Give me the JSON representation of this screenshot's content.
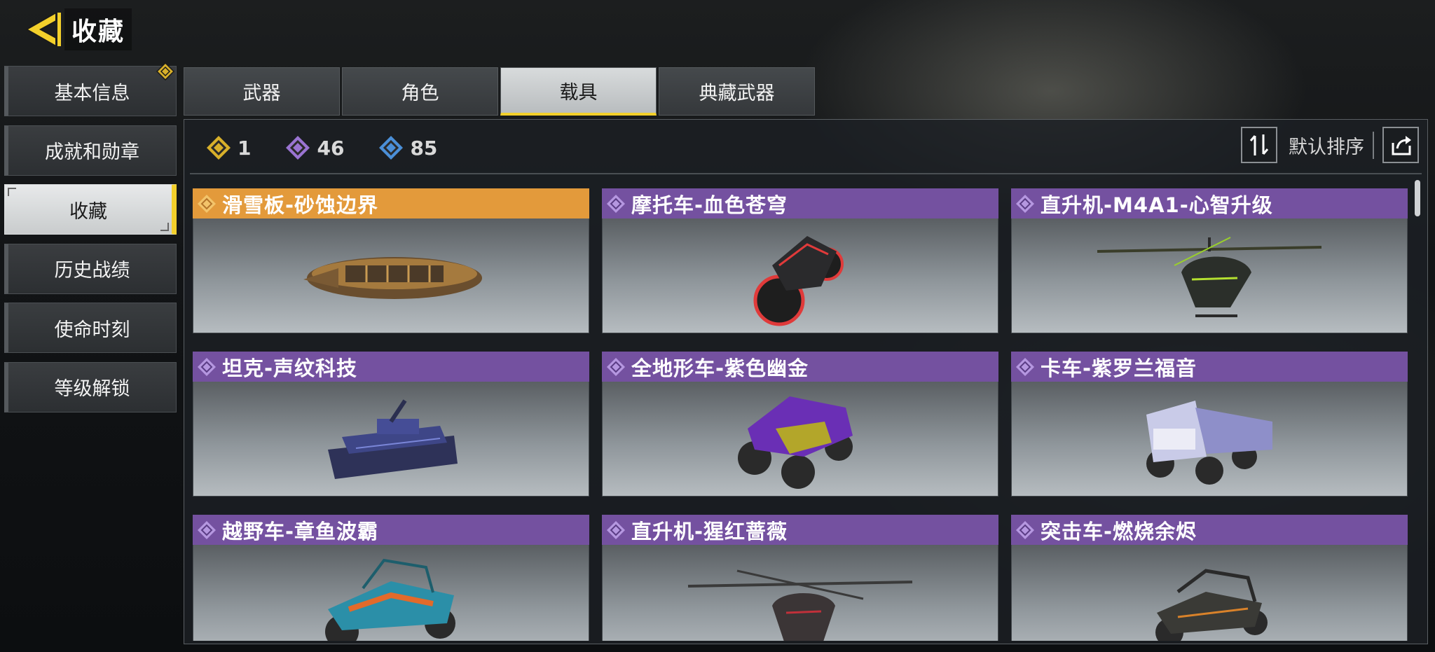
{
  "header": {
    "title": "收藏"
  },
  "sidebar": {
    "items": [
      {
        "label": "基本信息"
      },
      {
        "label": "成就和勋章"
      },
      {
        "label": "收藏"
      },
      {
        "label": "历史战绩"
      },
      {
        "label": "使命时刻"
      },
      {
        "label": "等级解锁"
      }
    ]
  },
  "tabs": [
    {
      "label": "武器"
    },
    {
      "label": "角色"
    },
    {
      "label": "载具"
    },
    {
      "label": "典藏武器"
    }
  ],
  "stats": {
    "legendary": "1",
    "epic": "46",
    "rare": "85"
  },
  "sort": {
    "label": "默认排序"
  },
  "cards": [
    {
      "name": "滑雪板-砂蚀边界",
      "rarity": "legendary"
    },
    {
      "name": "摩托车-血色苍穹",
      "rarity": "epic"
    },
    {
      "name": "直升机-M4A1-心智升级",
      "rarity": "epic"
    },
    {
      "name": "坦克-声纹科技",
      "rarity": "epic"
    },
    {
      "name": "全地形车-紫色幽金",
      "rarity": "epic"
    },
    {
      "name": "卡车-紫罗兰福音",
      "rarity": "epic"
    },
    {
      "name": "越野车-章鱼波霸",
      "rarity": "epic"
    },
    {
      "name": "直升机-猩红蔷薇",
      "rarity": "epic"
    },
    {
      "name": "突击车-燃烧余烬",
      "rarity": "epic"
    }
  ],
  "colors": {
    "accent": "#f3d02b",
    "legendary": "#e39a3b",
    "epic": "#7451a0",
    "rare": "#3a7ec8"
  }
}
